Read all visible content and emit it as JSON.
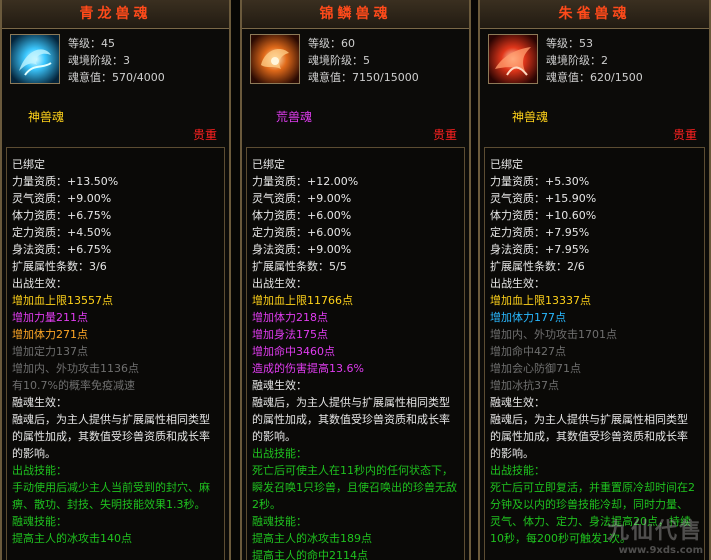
{
  "colors": {
    "title": "#ff4a1a",
    "rarity": "#ff2020",
    "green": "#1fd31f",
    "yellow": "#ffd21a"
  },
  "panels": [
    {
      "title": "青龙兽魂",
      "icon": "blue-dragon-spirit-icon",
      "level_label": "等级：",
      "level": "45",
      "stage_label": "魂境阶级：",
      "stage": "3",
      "exp_label": "魂意值：",
      "exp": "570/4000",
      "type": "神兽魂",
      "rarity": "贵重",
      "bound": "已绑定",
      "stats": [
        {
          "label": "力量资质：",
          "value": "+13.50%"
        },
        {
          "label": "灵气资质：",
          "value": "+9.00%"
        },
        {
          "label": "体力资质：",
          "value": "+6.75%"
        },
        {
          "label": "定力资质：",
          "value": "+4.50%"
        },
        {
          "label": "身法资质：",
          "value": "+6.75%"
        }
      ],
      "ext_label": "扩展属性条数：",
      "ext": "3/6",
      "battle_label": "出战生效：",
      "effects": [
        {
          "text": "增加血上限13557点",
          "c": "y"
        },
        {
          "text": "增加力量211点",
          "c": "m"
        },
        {
          "text": "增加体力271点",
          "c": "o"
        },
        {
          "text": "增加定力137点",
          "c": "dgray"
        },
        {
          "text": "增加内、外功攻击1136点",
          "c": "dgray"
        },
        {
          "text": "有10.7%的概率免疫减速",
          "c": "dgray"
        }
      ],
      "fuse_label": "融魂生效：",
      "fuse_desc": "融魂后，为主人提供与扩展属性相同类型的属性加成，其数值受珍兽资质和成长率的影响。",
      "skill_label": "出战技能：",
      "skill_desc": "手动使用后减少主人当前受到的封穴、麻痹、散功、封技、失明技能效果1.3秒。",
      "fuse_skill_label": "融魂技能：",
      "fuse_skill": "提高主人的冰攻击140点"
    },
    {
      "title": "锦鳞兽魂",
      "icon": "golden-scale-spirit-icon",
      "level_label": "等级：",
      "level": "60",
      "stage_label": "魂境阶级：",
      "stage": "5",
      "exp_label": "魂意值：",
      "exp": "7150/15000",
      "type": "荒兽魂",
      "rarity": "贵重",
      "bound": "已绑定",
      "stats": [
        {
          "label": "力量资质：",
          "value": "+12.00%"
        },
        {
          "label": "灵气资质：",
          "value": "+9.00%"
        },
        {
          "label": "体力资质：",
          "value": "+6.00%"
        },
        {
          "label": "定力资质：",
          "value": "+6.00%"
        },
        {
          "label": "身法资质：",
          "value": "+9.00%"
        }
      ],
      "ext_label": "扩展属性条数：",
      "ext": "5/5",
      "battle_label": "出战生效：",
      "effects": [
        {
          "text": "增加血上限11766点",
          "c": "y"
        },
        {
          "text": "增加体力218点",
          "c": "m"
        },
        {
          "text": "增加身法175点",
          "c": "m"
        },
        {
          "text": "增加命中3460点",
          "c": "m"
        },
        {
          "text": "造成的伤害提高13.6%",
          "c": "m"
        }
      ],
      "fuse_label": "融魂生效：",
      "fuse_desc": "融魂后，为主人提供与扩展属性相同类型的属性加成，其数值受珍兽资质和成长率的影响。",
      "skill_label": "出战技能：",
      "skill_desc": "死亡后可使主人在11秒内的任何状态下，瞬发召唤1只珍兽，且使召唤出的珍兽无敌2秒。",
      "fuse_skill_label": "融魂技能：",
      "fuse_skill": "提高主人的冰攻击189点",
      "fuse_skill2": "提高主人的命中2114点"
    },
    {
      "title": "朱雀兽魂",
      "icon": "vermilion-bird-spirit-icon",
      "level_label": "等级：",
      "level": "53",
      "stage_label": "魂境阶级：",
      "stage": "2",
      "exp_label": "魂意值：",
      "exp": "620/1500",
      "type": "神兽魂",
      "rarity": "贵重",
      "bound": "已绑定",
      "stats": [
        {
          "label": "力量资质：",
          "value": "+5.30%"
        },
        {
          "label": "灵气资质：",
          "value": "+15.90%"
        },
        {
          "label": "体力资质：",
          "value": "+10.60%"
        },
        {
          "label": "定力资质：",
          "value": "+7.95%"
        },
        {
          "label": "身法资质：",
          "value": "+7.95%"
        }
      ],
      "ext_label": "扩展属性条数：",
      "ext": "2/6",
      "battle_label": "出战生效：",
      "effects": [
        {
          "text": "增加血上限13337点",
          "c": "y"
        },
        {
          "text": "增加体力177点",
          "c": "b"
        },
        {
          "text": "增加内、外功攻击1701点",
          "c": "dgray"
        },
        {
          "text": "增加命中427点",
          "c": "dgray"
        },
        {
          "text": "增加会心防御71点",
          "c": "dgray"
        },
        {
          "text": "增加冰抗37点",
          "c": "dgray"
        }
      ],
      "fuse_label": "融魂生效：",
      "fuse_desc": "融魂后，为主人提供与扩展属性相同类型的属性加成，其数值受珍兽资质和成长率的影响。",
      "skill_label": "出战技能：",
      "skill_desc": "死亡后可立即复活，并重置原冷却时间在2分钟及以内的珍兽技能冷却，同时力量、灵气、体力、定力、身法提高20点，持续10秒，每200秒可触发1次。"
    }
  ],
  "watermark": {
    "title": "九仙代售",
    "sub": "www.9xds.com"
  }
}
